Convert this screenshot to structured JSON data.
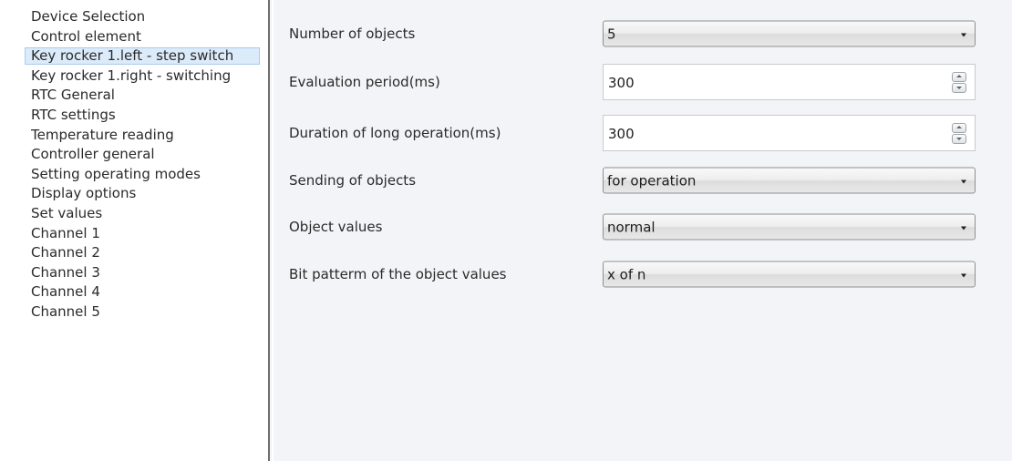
{
  "sidebar": {
    "items": [
      {
        "label": "Device Selection",
        "selected": false
      },
      {
        "label": "Control element",
        "selected": false
      },
      {
        "label": "Key rocker 1.left - step switch",
        "selected": true
      },
      {
        "label": "Key rocker 1.right - switching",
        "selected": false
      },
      {
        "label": "RTC General",
        "selected": false
      },
      {
        "label": "RTC settings",
        "selected": false
      },
      {
        "label": "Temperature reading",
        "selected": false
      },
      {
        "label": "Controller general",
        "selected": false
      },
      {
        "label": "Setting operating modes",
        "selected": false
      },
      {
        "label": "Display options",
        "selected": false
      },
      {
        "label": "Set values",
        "selected": false
      },
      {
        "label": "Channel 1",
        "selected": false
      },
      {
        "label": "Channel 2",
        "selected": false
      },
      {
        "label": "Channel 3",
        "selected": false
      },
      {
        "label": "Channel 4",
        "selected": false
      },
      {
        "label": "Channel 5",
        "selected": false
      }
    ]
  },
  "params": {
    "number_of_objects": {
      "label": "Number of objects",
      "value": "5"
    },
    "evaluation_period": {
      "label": "Evaluation period(ms)",
      "value": "300"
    },
    "long_operation": {
      "label": "Duration of long operation(ms)",
      "value": "300"
    },
    "sending_of_objects": {
      "label": "Sending of objects",
      "value": "for operation"
    },
    "object_values": {
      "label": "Object values",
      "value": "normal"
    },
    "bit_pattern": {
      "label": "Bit patterm of the object values",
      "value": "x of n"
    }
  },
  "icons": {
    "dropdown": "chevron-down-icon",
    "spin_up": "spin-up-icon",
    "spin_down": "spin-down-icon"
  },
  "colors": {
    "selection_fill": "#dcebfa",
    "selection_border": "#a9cbee",
    "panel_background": "#f2f4f7",
    "splitter": "#6f6f6f"
  }
}
